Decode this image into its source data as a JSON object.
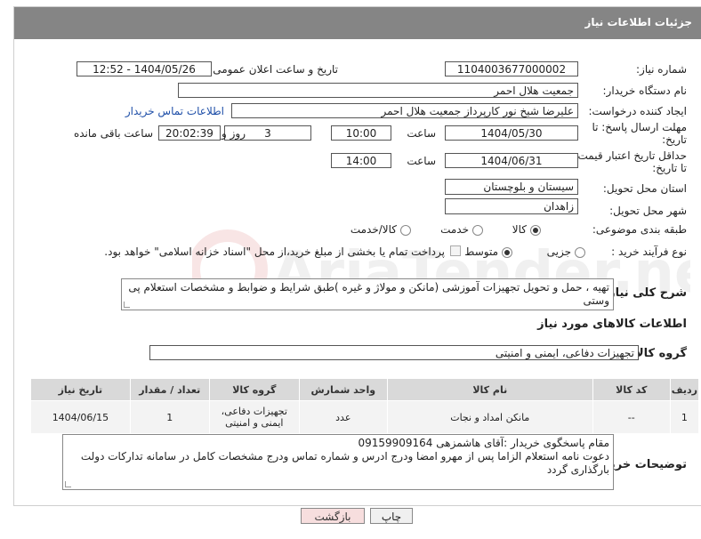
{
  "header": {
    "title": "جزئیات اطلاعات نیاز"
  },
  "form": {
    "need_number_label": "شماره نیاز:",
    "need_number": "1104003677000002",
    "announce_label": "تاریخ و ساعت اعلان عمومی:",
    "announce_value": "1404/05/26 - 12:52",
    "buyer_org_label": "نام دستگاه خریدار:",
    "buyer_org": "جمعیت هلال احمر",
    "creator_label": "ایجاد کننده درخواست:",
    "creator": "علیرضا شیخ نور کارپرداز جمعیت هلال احمر",
    "contact_link": "اطلاعات تماس خریدار",
    "deadline_label": "مهلت ارسال پاسخ: تا تاریخ:",
    "deadline_date": "1404/05/30",
    "time_label": "ساعت",
    "deadline_time": "10:00",
    "days_value": "3",
    "days_label": "روز و",
    "remaining_time": "20:02:39",
    "remaining_label": "ساعت باقی مانده",
    "price_validity_label": "حداقل تاریخ اعتبار قیمت: تا تاریخ:",
    "price_date": "1404/06/31",
    "price_time": "14:00",
    "province_label": "استان محل تحویل:",
    "province": "سیستان و بلوچستان",
    "city_label": "شهر محل تحویل:",
    "city": "زاهدان",
    "category_label": "طبقه بندی موضوعی:",
    "category_options": [
      "کالا",
      "خدمت",
      "کالا/خدمت"
    ],
    "process_label": "نوع فرآیند خرید :",
    "process_options": [
      "جزیی",
      "متوسط"
    ],
    "payment_note": "پرداخت تمام یا بخشی از مبلغ خرید،از محل \"اسناد خزانه اسلامی\" خواهد بود.",
    "description_label": "شرح کلی نیاز:",
    "description": "تهیه ، حمل و تحویل تجهیزات آموزشی (مانکن و مولاژ و غیره )طبق شرایط و ضوابط و مشخصات استعلام پی وستی"
  },
  "goods": {
    "section_title": "اطلاعات کالاهای مورد نیاز",
    "group_label": "گروه کالا:",
    "group_value": "تجهیزات دفاعی، ایمنی و امنیتی",
    "columns": [
      "ردیف",
      "کد کالا",
      "نام کالا",
      "واحد شمارش",
      "گروه کالا",
      "تعداد / مقدار",
      "تاریخ نیاز"
    ],
    "rows": [
      [
        "1",
        "--",
        "مانکن امداد و نجات",
        "عدد",
        "تجهیزات دفاعی، ایمنی و امنیتی",
        "1",
        "1404/06/15"
      ]
    ]
  },
  "buyer_notes": {
    "label": "توضیحات خریدار:",
    "line1": "مقام پاسخگوی خریدار :آقای هاشمزهی 09159909164",
    "line2": "دعوت نامه استعلام الزاما پس از مهرو امضا ودرج ادرس و شماره تماس ودرج مشخصات کامل در سامانه تدارکات دولت بارگذاری گردد"
  },
  "footer": {
    "print_label": "چاپ",
    "back_label": "بازگشت"
  },
  "watermark": {
    "text": "AriaTender.neT"
  }
}
